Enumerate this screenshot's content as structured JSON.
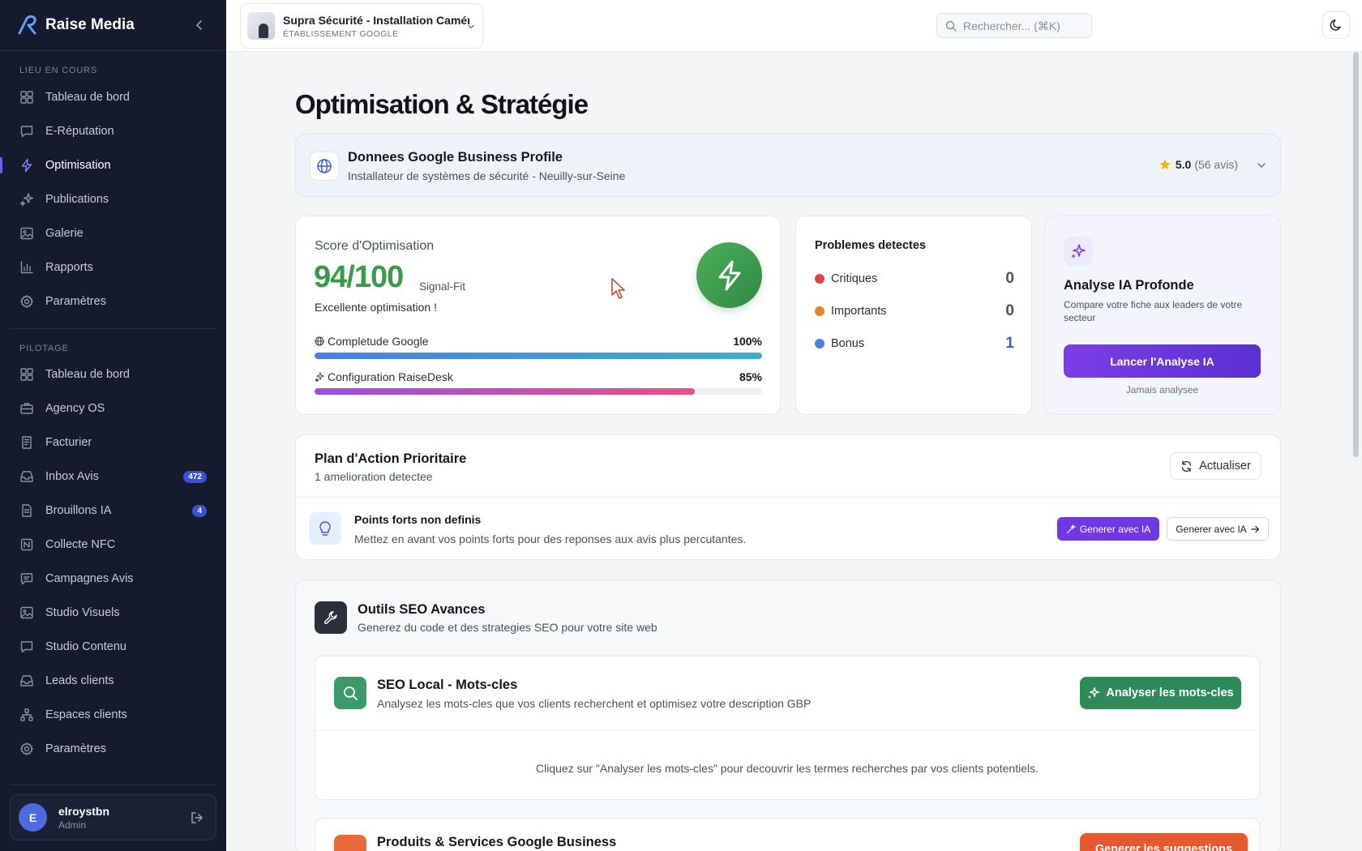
{
  "brand": {
    "name": "Raise Media"
  },
  "sidebar": {
    "current_section": "LIEU EN COURS",
    "current_items": [
      {
        "label": "Tableau de bord",
        "icon": "dashboard-icon"
      },
      {
        "label": "E-Réputation",
        "icon": "chat-icon"
      },
      {
        "label": "Optimisation",
        "icon": "bolt-icon",
        "active": true
      },
      {
        "label": "Publications",
        "icon": "sparkles-icon"
      },
      {
        "label": "Galerie",
        "icon": "image-icon"
      },
      {
        "label": "Rapports",
        "icon": "bar-chart-icon"
      },
      {
        "label": "Paramètres",
        "icon": "gear-icon"
      }
    ],
    "pilot_section": "PILOTAGE",
    "pilot_items": [
      {
        "label": "Tableau de bord",
        "icon": "dashboard-icon"
      },
      {
        "label": "Agency OS",
        "icon": "briefcase-icon"
      },
      {
        "label": "Facturier",
        "icon": "invoice-icon"
      },
      {
        "label": "Inbox Avis",
        "icon": "inbox-icon",
        "badge": "472"
      },
      {
        "label": "Brouillons IA",
        "icon": "document-icon",
        "badge": "4"
      },
      {
        "label": "Collecte NFC",
        "icon": "nfc-icon"
      },
      {
        "label": "Campagnes Avis",
        "icon": "campaign-icon"
      },
      {
        "label": "Studio Visuels",
        "icon": "image-icon"
      },
      {
        "label": "Studio Contenu",
        "icon": "chat-icon"
      },
      {
        "label": "Leads clients",
        "icon": "inbox-icon"
      },
      {
        "label": "Espaces clients",
        "icon": "network-icon"
      },
      {
        "label": "Paramètres",
        "icon": "gear-icon"
      }
    ],
    "user": {
      "initial": "E",
      "name": "elroystbn",
      "role": "Admin"
    }
  },
  "topbar": {
    "location_name": "Supra Sécurité - Installation Caméra, Alarme",
    "location_type": "ÉTABLISSEMENT GOOGLE",
    "search_placeholder": "Rechercher... (⌘K)"
  },
  "page": {
    "title": "Optimisation & Stratégie"
  },
  "gbp": {
    "title": "Donnees Google Business Profile",
    "subtitle": "Installateur de systèmes de sécurité - Neuilly-sur-Seine",
    "rating": "5.0",
    "reviews": "(56 avis)"
  },
  "score": {
    "label": "Score d'Optimisation",
    "value": "94/100",
    "tag": "Signal-Fit",
    "message": "Excellente optimisation !",
    "bars": [
      {
        "label": "Completude Google",
        "pct_text": "100%",
        "value": 100,
        "color_from": "#4a7fe0",
        "color_to": "#3ab0c8"
      },
      {
        "label": "Configuration RaiseDesk",
        "pct_text": "85%",
        "value": 85,
        "color_from": "#9b4fe0",
        "color_to": "#e8508a"
      }
    ]
  },
  "issues": {
    "title": "Problemes detectes",
    "rows": [
      {
        "label": "Critiques",
        "count": "0",
        "color": "#e04545"
      },
      {
        "label": "Importants",
        "count": "0",
        "color": "#f0822e"
      },
      {
        "label": "Bonus",
        "count": "1",
        "color": "#4a7fe0"
      }
    ]
  },
  "ai_analysis": {
    "title": "Analyse IA Profonde",
    "description": "Compare votre fiche aux leaders de votre secteur",
    "button": "Lancer l'Analyse IA",
    "footer": "Jamais analysee"
  },
  "plan": {
    "title": "Plan d'Action Prioritaire",
    "subtitle": "1 amelioration detectee",
    "refresh": "Actualiser",
    "item": {
      "title": "Points forts non definis",
      "description": "Mettez en avant vos points forts pour des reponses aux avis plus percutantes.",
      "primary": "Generer avec IA",
      "secondary": "Generer avec IA"
    }
  },
  "seo": {
    "title": "Outils SEO Avances",
    "subtitle": "Generez du code et des strategies SEO pour votre site web",
    "keywords": {
      "title": "SEO Local - Mots-cles",
      "subtitle": "Analysez les mots-cles que vos clients recherchent et optimisez votre description GBP",
      "button": "Analyser les mots-cles",
      "empty": "Cliquez sur \"Analyser les mots-cles\" pour decouvrir les termes recherches par vos clients potentiels."
    },
    "products": {
      "title": "Produits & Services Google Business",
      "button": "Generer les suggestions"
    }
  }
}
